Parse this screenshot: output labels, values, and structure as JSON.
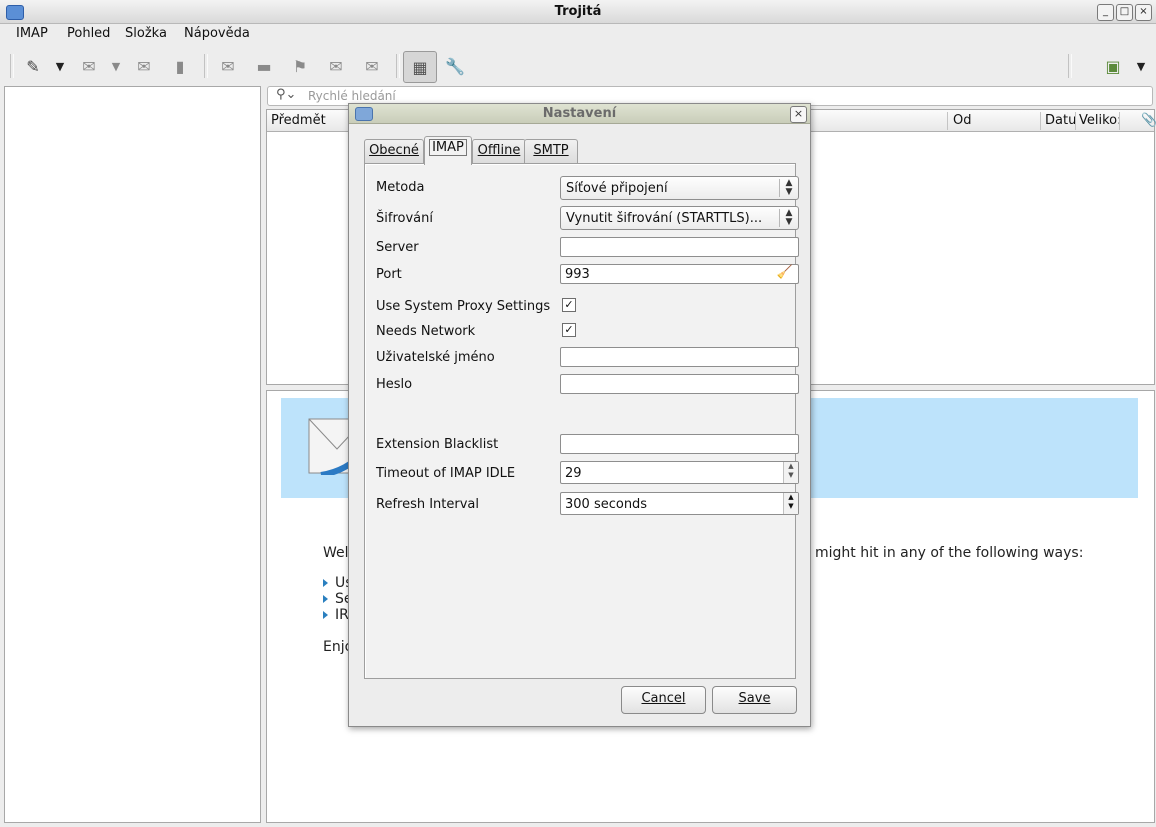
{
  "window": {
    "title": "Trojitá"
  },
  "menu": [
    "IMAP",
    "Pohled",
    "Složka",
    "Nápověda"
  ],
  "search": {
    "placeholder": "Rychlé hledání"
  },
  "columns": {
    "subject": "Předmět",
    "from": "Od",
    "date": "Datu",
    "size": "Veliko:"
  },
  "welcome": {
    "line1_start": "Wel",
    "line1_end": "might hit in any of the following ways:",
    "bullets": [
      "Us",
      "Se",
      "IR"
    ],
    "enjoy": "Enjo"
  },
  "dialog": {
    "title": "Nastavení",
    "tabs": [
      "Obecné",
      "IMAP",
      "Offline",
      "SMTP"
    ],
    "active_tab": "IMAP",
    "fields": {
      "method_label": "Metoda",
      "method_value": "Síťové připojení",
      "encryption_label": "Šifrování",
      "encryption_value": "Vynutit šifrování (STARTTLS)...",
      "server_label": "Server",
      "server_value": "",
      "port_label": "Port",
      "port_value": "993",
      "proxy_label": "Use System Proxy Settings",
      "proxy_checked": true,
      "network_label": "Needs Network",
      "network_checked": true,
      "username_label": "Uživatelské jméno",
      "username_value": "",
      "password_label": "Heslo",
      "password_value": "",
      "blacklist_label": "Extension Blacklist",
      "blacklist_value": "",
      "idle_label": "Timeout of IMAP IDLE",
      "idle_value": "29",
      "refresh_label": "Refresh Interval",
      "refresh_value": "300 seconds"
    },
    "buttons": {
      "cancel": "Cancel",
      "save": "Save"
    }
  },
  "colors": {
    "banner": "#bde3fb",
    "bullet": "#2a7fbf"
  }
}
